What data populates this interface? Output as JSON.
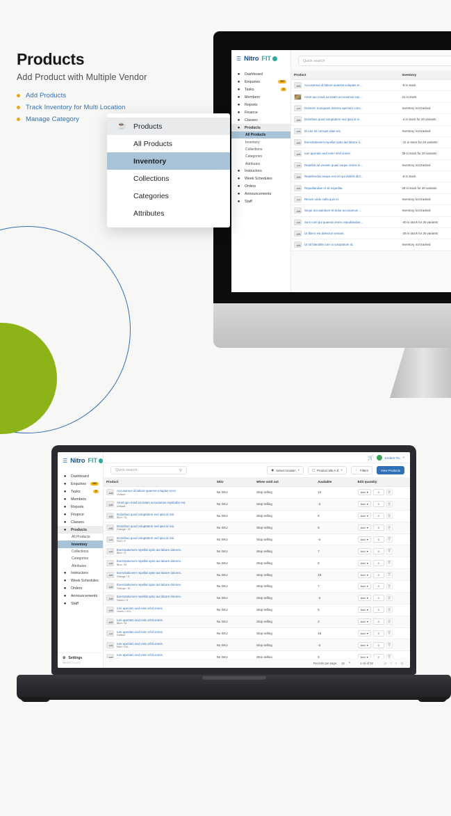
{
  "headline": {
    "title": "Products",
    "subtitle": "Add Product with Multiple Vendor",
    "bullets": [
      {
        "label": "Add Products"
      },
      {
        "label": "Track Inventory for Multi Location"
      },
      {
        "label": "Manage Category"
      }
    ]
  },
  "menu_card": {
    "header": {
      "label": "Products",
      "icon": "products-icon"
    },
    "items": [
      {
        "label": "All Products",
        "selected": false
      },
      {
        "label": "Inventory",
        "selected": true
      },
      {
        "label": "Collections",
        "selected": false
      },
      {
        "label": "Categories",
        "selected": false
      },
      {
        "label": "Attributes",
        "selected": false
      }
    ]
  },
  "brand": {
    "part1": "Nitro",
    "part2": "FIT",
    "menu_icon": "hamburger-icon"
  },
  "sidebar": {
    "items": [
      {
        "label": "Dashboard",
        "icon": "dashboard-icon",
        "badge": ""
      },
      {
        "label": "Enquiries",
        "icon": "enquiries-icon",
        "badge": "192"
      },
      {
        "label": "Tasks",
        "icon": "tasks-icon",
        "badge": "3"
      },
      {
        "label": "Members",
        "icon": "members-icon",
        "badge": ""
      },
      {
        "label": "Reports",
        "icon": "reports-icon",
        "badge": ""
      },
      {
        "label": "Finance",
        "icon": "finance-icon",
        "badge": ""
      },
      {
        "label": "Classes",
        "icon": "classes-icon",
        "badge": ""
      },
      {
        "label": "Products",
        "icon": "products-icon",
        "badge": ""
      }
    ],
    "sub_items": [
      {
        "label": "All Products"
      },
      {
        "label": "Inventory"
      },
      {
        "label": "Collections"
      },
      {
        "label": "Categories"
      },
      {
        "label": "Attributes"
      }
    ],
    "items_after": [
      {
        "label": "Instructors",
        "icon": "instructors-icon"
      },
      {
        "label": "Week Schedules",
        "icon": "calendar-icon"
      },
      {
        "label": "Orders",
        "icon": "orders-icon"
      },
      {
        "label": "Announcements",
        "icon": "announcement-icon"
      },
      {
        "label": "Staff",
        "icon": "staff-icon"
      }
    ],
    "settings_label": "Settings",
    "settings_icon": "gear-icon",
    "version": "NitroFIT2.0 v2.0"
  },
  "search": {
    "placeholder": "Quick search",
    "icon": "search-icon"
  },
  "monitor_screen": {
    "active_nav": "All Products",
    "columns": [
      "Product",
      "Inventory"
    ],
    "rows": [
      {
        "product": "Accusamus id labore quaerat voluptas er...",
        "inventory": "-9 in stock",
        "photo": false
      },
      {
        "product": "Amet quo modi ea totam accusamus exp...",
        "inventory": "31 in stock",
        "photo": true
      },
      {
        "product": "Dolorem numquam dolores aperiam cons...",
        "inventory": "Inventory not tracked",
        "photo": false
      },
      {
        "product": "Doloribus quod voluptatem sed ipsa id ni...",
        "inventory": "-4 in stock for 20 variants",
        "photo": false
      },
      {
        "product": "Et iure sit corrupti vitae est.",
        "inventory": "Inventory not tracked",
        "photo": false
      },
      {
        "product": "Exercitationem repellat optio aut labore d...",
        "inventory": "-11 in stock for 20 variants",
        "photo": false
      },
      {
        "product": "Iure aperiam sed enim nihil omnis.",
        "inventory": "39 in stock for 20 variants",
        "photo": false
      },
      {
        "product": "Repellat ad veniam quasi eaque omnis te...",
        "inventory": "Inventory not tracked",
        "photo": false
      },
      {
        "product": "Repellendus eaque est vel qui debitis dict...",
        "inventory": "-6 in stock",
        "photo": false
      },
      {
        "product": "Repudiandae et sit expedita.",
        "inventory": "28 in stock for 20 variants",
        "photo": false
      },
      {
        "product": "Rerum unde nulla quis et.",
        "inventory": "Inventory not tracked",
        "photo": false
      },
      {
        "product": "Sequi accusantium sit dolor accusamus ...",
        "inventory": "Inventory not tracked",
        "photo": false
      },
      {
        "product": "Sunt cum qui quaerat omnis repudiandae...",
        "inventory": "-40 in stock for 20 variants",
        "photo": false
      },
      {
        "product": "Ut libero est delectus veniam.",
        "inventory": "-25 in stock for 20 variants",
        "photo": false
      },
      {
        "product": "Ut sit blanditiis iure ut voluptatum id.",
        "inventory": "Inventory not tracked",
        "photo": false
      }
    ]
  },
  "laptop_screen": {
    "active_nav": "Inventory",
    "topbar": {
      "cart_icon": "cart-icon",
      "user_name": "Enders Tin",
      "avatar": "avatar",
      "caret": "chevron-down-icon"
    },
    "toolbar": {
      "location_label": "Select location",
      "location_icon": "location-icon",
      "sort_label": "Product title A-Z",
      "sort_icon": "sort-icon",
      "filters_label": "Filters",
      "filters_icon": "filter-icon",
      "view_products_label": "View Products"
    },
    "columns": [
      "Product",
      "SKU",
      "When sold out",
      "Available",
      "Edit quantity"
    ],
    "rows": [
      {
        "product": "Accusamus id labore quaerat voluptas error.",
        "variant": "Default",
        "sku": "No SKU",
        "sold_out": "Stop selling",
        "available": "10",
        "qty_action": "Add",
        "qty_value": "0"
      },
      {
        "product": "Amet quo modi ea totam accusamus explicabo est.",
        "variant": "Default",
        "sku": "No SKU",
        "sold_out": "Stop selling",
        "available": "-4",
        "qty_action": "Add",
        "qty_value": "0"
      },
      {
        "product": "Doloribus quod voluptatem sed ipsa id nisi.",
        "variant": "Blue / XL",
        "sku": "No SKU",
        "sold_out": "Stop selling",
        "available": "6",
        "qty_action": "Add",
        "qty_value": "0"
      },
      {
        "product": "Doloribus quod voluptatem sed ipsa id nisi.",
        "variant": "Orange / XL",
        "sku": "No SKU",
        "sold_out": "Stop selling",
        "available": "8",
        "qty_action": "Add",
        "qty_value": "0"
      },
      {
        "product": "Doloribus quod voluptatem sed ipsa id nisi.",
        "variant": "Red / S",
        "sku": "No SKU",
        "sold_out": "Stop selling",
        "available": "-4",
        "qty_action": "Add",
        "qty_value": "0"
      },
      {
        "product": "Exercitationem repellat optio aut labore dolores.",
        "variant": "Blue / S",
        "sku": "No SKU",
        "sold_out": "Stop selling",
        "available": "7",
        "qty_action": "Add",
        "qty_value": "0"
      },
      {
        "product": "Exercitationem repellat optio aut labore dolores.",
        "variant": "Blue / M",
        "sku": "No SKU",
        "sold_out": "Stop selling",
        "available": "6",
        "qty_action": "Add",
        "qty_value": "0"
      },
      {
        "product": "Exercitationem repellat optio aut labore dolores.",
        "variant": "Orange / S",
        "sku": "No SKU",
        "sold_out": "Stop selling",
        "available": "18",
        "qty_action": "Add",
        "qty_value": "0"
      },
      {
        "product": "Exercitationem repellat optio aut labore dolores.",
        "variant": "Orange / M",
        "sku": "No SKU",
        "sold_out": "Stop selling",
        "available": "7",
        "qty_action": "Add",
        "qty_value": "0"
      },
      {
        "product": "Exercitationem repellat optio aut labore dolores.",
        "variant": "Green / S",
        "sku": "No SKU",
        "sold_out": "Stop selling",
        "available": "-4",
        "qty_action": "Add",
        "qty_value": "0"
      },
      {
        "product": "Iure aperiam sed enim nihil omnis.",
        "variant": "Green / XXL",
        "sku": "No SKU",
        "sold_out": "Stop selling",
        "available": "6",
        "qty_action": "Add",
        "qty_value": "0"
      },
      {
        "product": "Iure aperiam sed enim nihil omnis.",
        "variant": "Blue / M",
        "sku": "No SKU",
        "sold_out": "Stop selling",
        "available": "2",
        "qty_action": "Add",
        "qty_value": "0"
      },
      {
        "product": "Iure aperiam sed enim nihil omnis.",
        "variant": "Default",
        "sku": "No SKU",
        "sold_out": "Stop selling",
        "available": "16",
        "qty_action": "Add",
        "qty_value": "0"
      },
      {
        "product": "Iure aperiam sed enim nihil omnis.",
        "variant": "Red / XXL",
        "sku": "No SKU",
        "sold_out": "Stop selling",
        "available": "-4",
        "qty_action": "Add",
        "qty_value": "0"
      },
      {
        "product": "Iure aperiam sed enim nihil omnis.",
        "variant": "Green / L",
        "sku": "No SKU",
        "sold_out": "Stop selling",
        "available": "6",
        "qty_action": "Add",
        "qty_value": "0"
      }
    ],
    "footer": {
      "records_label": "Records per page:",
      "records_value": "15",
      "range_label": "1-15 of 52",
      "first_icon": "first-page-icon",
      "prev_icon": "prev-page-icon",
      "next_icon": "next-page-icon",
      "last_icon": "last-page-icon"
    }
  },
  "colors": {
    "accent_blue": "#2f6fb5",
    "brand_teal": "#2fa8a0",
    "bullet_amber": "#e8a820",
    "green_circle": "#8cb318",
    "selected_row": "#a8c3d8"
  }
}
